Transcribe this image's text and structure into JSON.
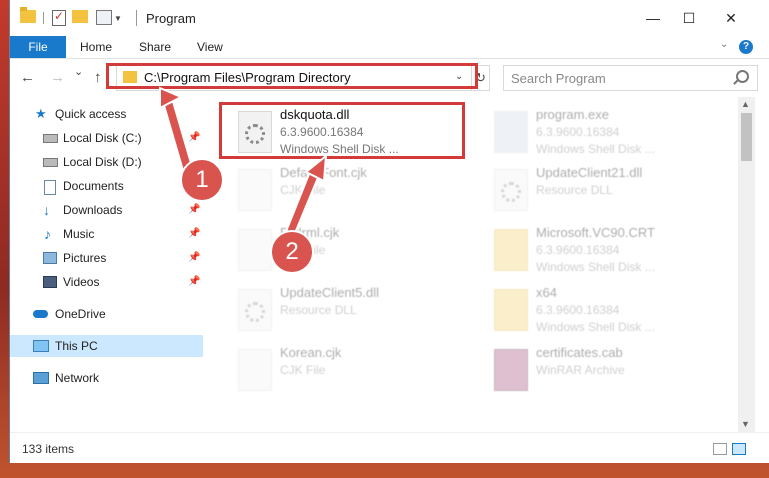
{
  "window": {
    "title": "Program",
    "controls": {
      "minimize": "—",
      "maximize": "☐",
      "close": "✕"
    }
  },
  "ribbon": {
    "file": "File",
    "home": "Home",
    "share": "Share",
    "view": "View"
  },
  "navigation": {
    "back": "←",
    "forward": "→",
    "recent": "⌄",
    "up": "↑",
    "address": "C:\\Program Files\\Program Directory",
    "refresh": "↻",
    "search_placeholder": "Search Program"
  },
  "sidebar": {
    "quick_access": "Quick access",
    "items": [
      {
        "label": "Local Disk (C:)",
        "icon": "drive-icon",
        "pinned": true
      },
      {
        "label": "Local Disk (D:)",
        "icon": "drive-icon",
        "pinned": false
      },
      {
        "label": "Documents",
        "icon": "documents-icon",
        "pinned": true
      },
      {
        "label": "Downloads",
        "icon": "downloads-icon",
        "pinned": true
      },
      {
        "label": "Music",
        "icon": "music-icon",
        "pinned": true
      },
      {
        "label": "Pictures",
        "icon": "pictures-icon",
        "pinned": true
      },
      {
        "label": "Videos",
        "icon": "videos-icon",
        "pinned": true
      }
    ],
    "onedrive": "OneDrive",
    "this_pc": "This PC",
    "network": "Network"
  },
  "files": [
    {
      "name": "dskquota.dll",
      "line1": "6.3.9600.16384",
      "line2": "Windows Shell Disk ...",
      "icon": "dll-gear-icon",
      "highlighted": true
    },
    {
      "name": "program.exe",
      "line1": "6.3.9600.16384",
      "line2": "Windows Shell Disk ...",
      "icon": "exe-icon"
    },
    {
      "name": "DefaultFont.cjk",
      "line1": "CJK File",
      "line2": "",
      "icon": "file-icon"
    },
    {
      "name": "UpdateClient21.dll",
      "line1": "Resource DLL",
      "line2": "",
      "icon": "dll-gear-icon"
    },
    {
      "name": "Extlrml.cjk",
      "line1": "CJK File",
      "line2": "",
      "icon": "file-icon"
    },
    {
      "name": "Microsoft.VC90.CRT",
      "line1": "6.3.9600.16384",
      "line2": "Windows Shell Disk ...",
      "icon": "folder-icon"
    },
    {
      "name": "UpdateClient5.dll",
      "line1": "Resource DLL",
      "line2": "",
      "icon": "dll-gear-icon"
    },
    {
      "name": "x64",
      "line1": "6.3.9600.16384",
      "line2": "Windows Shell Disk ...",
      "icon": "folder-icon"
    },
    {
      "name": "Korean.cjk",
      "line1": "CJK File",
      "line2": "",
      "icon": "file-icon"
    },
    {
      "name": "certificates.cab",
      "line1": "WinRAR Archive",
      "line2": "",
      "icon": "archive-icon"
    }
  ],
  "status": {
    "item_count": "133 items"
  },
  "callouts": {
    "one": "1",
    "two": "2"
  },
  "colors": {
    "accent": "#1979ca",
    "highlight": "#d33a3a",
    "selected": "#cce8ff"
  }
}
